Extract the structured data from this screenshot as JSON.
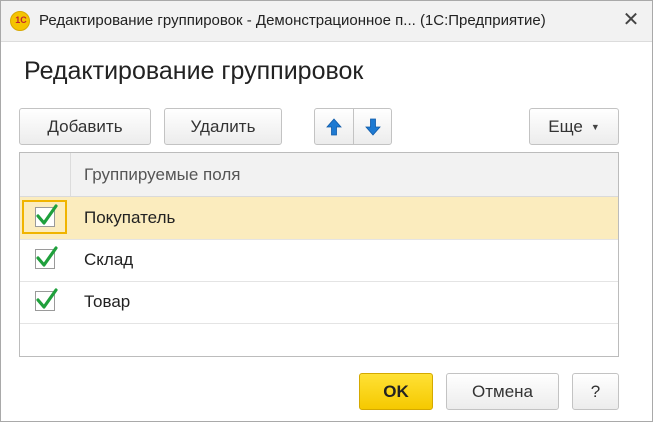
{
  "window": {
    "title": "Редактирование группировок - Демонстрационное п...  (1С:Предприятие)",
    "logo_text": "1С",
    "close_glyph": "✕"
  },
  "form": {
    "title": "Редактирование группировок"
  },
  "toolbar": {
    "add_label": "Добавить",
    "delete_label": "Удалить",
    "move_up_icon": "arrow-up-icon",
    "move_down_icon": "arrow-down-icon",
    "more_label": "Еще",
    "more_caret": "▼"
  },
  "table": {
    "header": "Группируемые поля",
    "rows": [
      {
        "label": "Покупатель",
        "checked": true,
        "selected": true
      },
      {
        "label": "Склад",
        "checked": true,
        "selected": false
      },
      {
        "label": "Товар",
        "checked": true,
        "selected": false
      }
    ]
  },
  "footer": {
    "ok_label": "OK",
    "cancel_label": "Отмена",
    "help_label": "?"
  },
  "colors": {
    "accent_ok": "#f5c900",
    "selection": "#fbecbe",
    "arrow_blue": "#1e7ad2",
    "checkmark_green": "#1fa03c"
  }
}
